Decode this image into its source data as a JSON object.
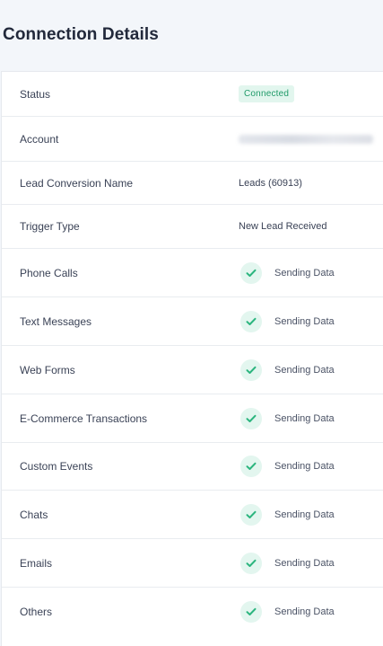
{
  "header": {
    "title": "Connection Details"
  },
  "rows": [
    {
      "label": "Status",
      "value": "Connected",
      "type": "badge"
    },
    {
      "label": "Account",
      "value": "",
      "type": "redacted"
    },
    {
      "label": "Lead Conversion Name",
      "value": "Leads (60913)",
      "type": "text"
    },
    {
      "label": "Trigger Type",
      "value": "New Lead Received",
      "type": "text"
    },
    {
      "label": "Phone Calls",
      "value": "Sending Data",
      "type": "check"
    },
    {
      "label": "Text Messages",
      "value": "Sending Data",
      "type": "check"
    },
    {
      "label": "Web Forms",
      "value": "Sending Data",
      "type": "check"
    },
    {
      "label": "E-Commerce Transactions",
      "value": "Sending Data",
      "type": "check"
    },
    {
      "label": "Custom Events",
      "value": "Sending Data",
      "type": "check"
    },
    {
      "label": "Chats",
      "value": "Sending Data",
      "type": "check"
    },
    {
      "label": "Emails",
      "value": "Sending Data",
      "type": "check"
    },
    {
      "label": "Others",
      "value": "Sending Data",
      "type": "check"
    }
  ],
  "colors": {
    "accent_green": "#1f9a68",
    "badge_bg": "#e2f6ee",
    "check_bg": "#e3f6ef",
    "page_bg": "#f3f6fa"
  },
  "icons": {
    "status_check": "check-circle-icon"
  }
}
